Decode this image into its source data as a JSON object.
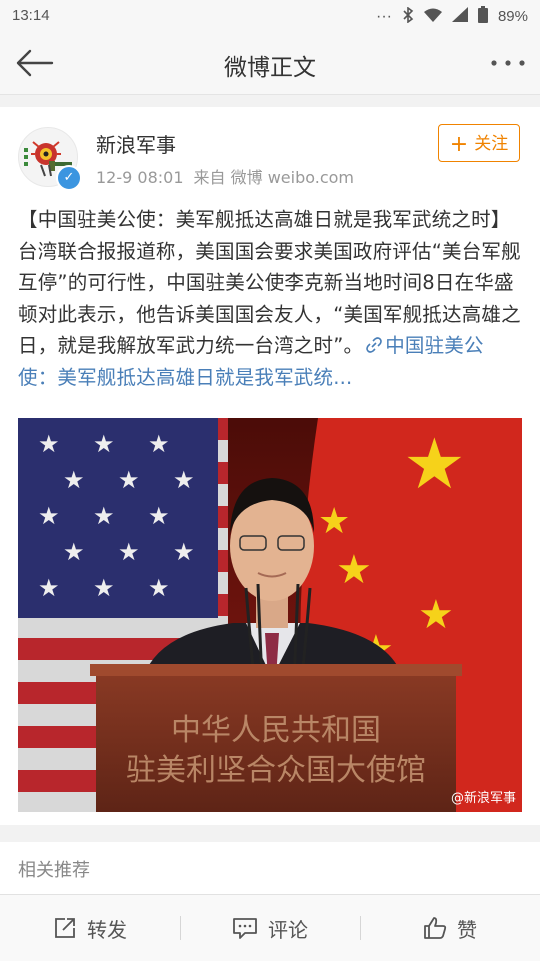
{
  "status_bar": {
    "time": "13:14",
    "battery": "89%"
  },
  "nav": {
    "title": "微博正文"
  },
  "post": {
    "username": "新浪军事",
    "time": "12-9 08:01",
    "source": "来自 微博 weibo.com",
    "follow_label": "关注",
    "text": "【中国驻美公使：美军舰抵达高雄日就是我军武统之时】台湾联合报报道称，美国国会要求美国政府评估“美台军舰互停”的可行性，中国驻美公使李克新当地时间8日在华盛顿对此表示，他告诉美国国会友人，“美国军舰抵达高雄之日，就是我解放军武力统一台湾之时”。",
    "link_text": "中国驻美公使：美军舰抵达高雄日就是我军武统...",
    "photo": {
      "podium_line1": "中华人民共和国",
      "podium_line2": "驻美利坚合众国大使馆",
      "watermark": "@新浪军事"
    }
  },
  "recommend": {
    "label": "相关推荐"
  },
  "toolbar": {
    "repost": "转发",
    "comment": "评论",
    "like": "赞"
  }
}
